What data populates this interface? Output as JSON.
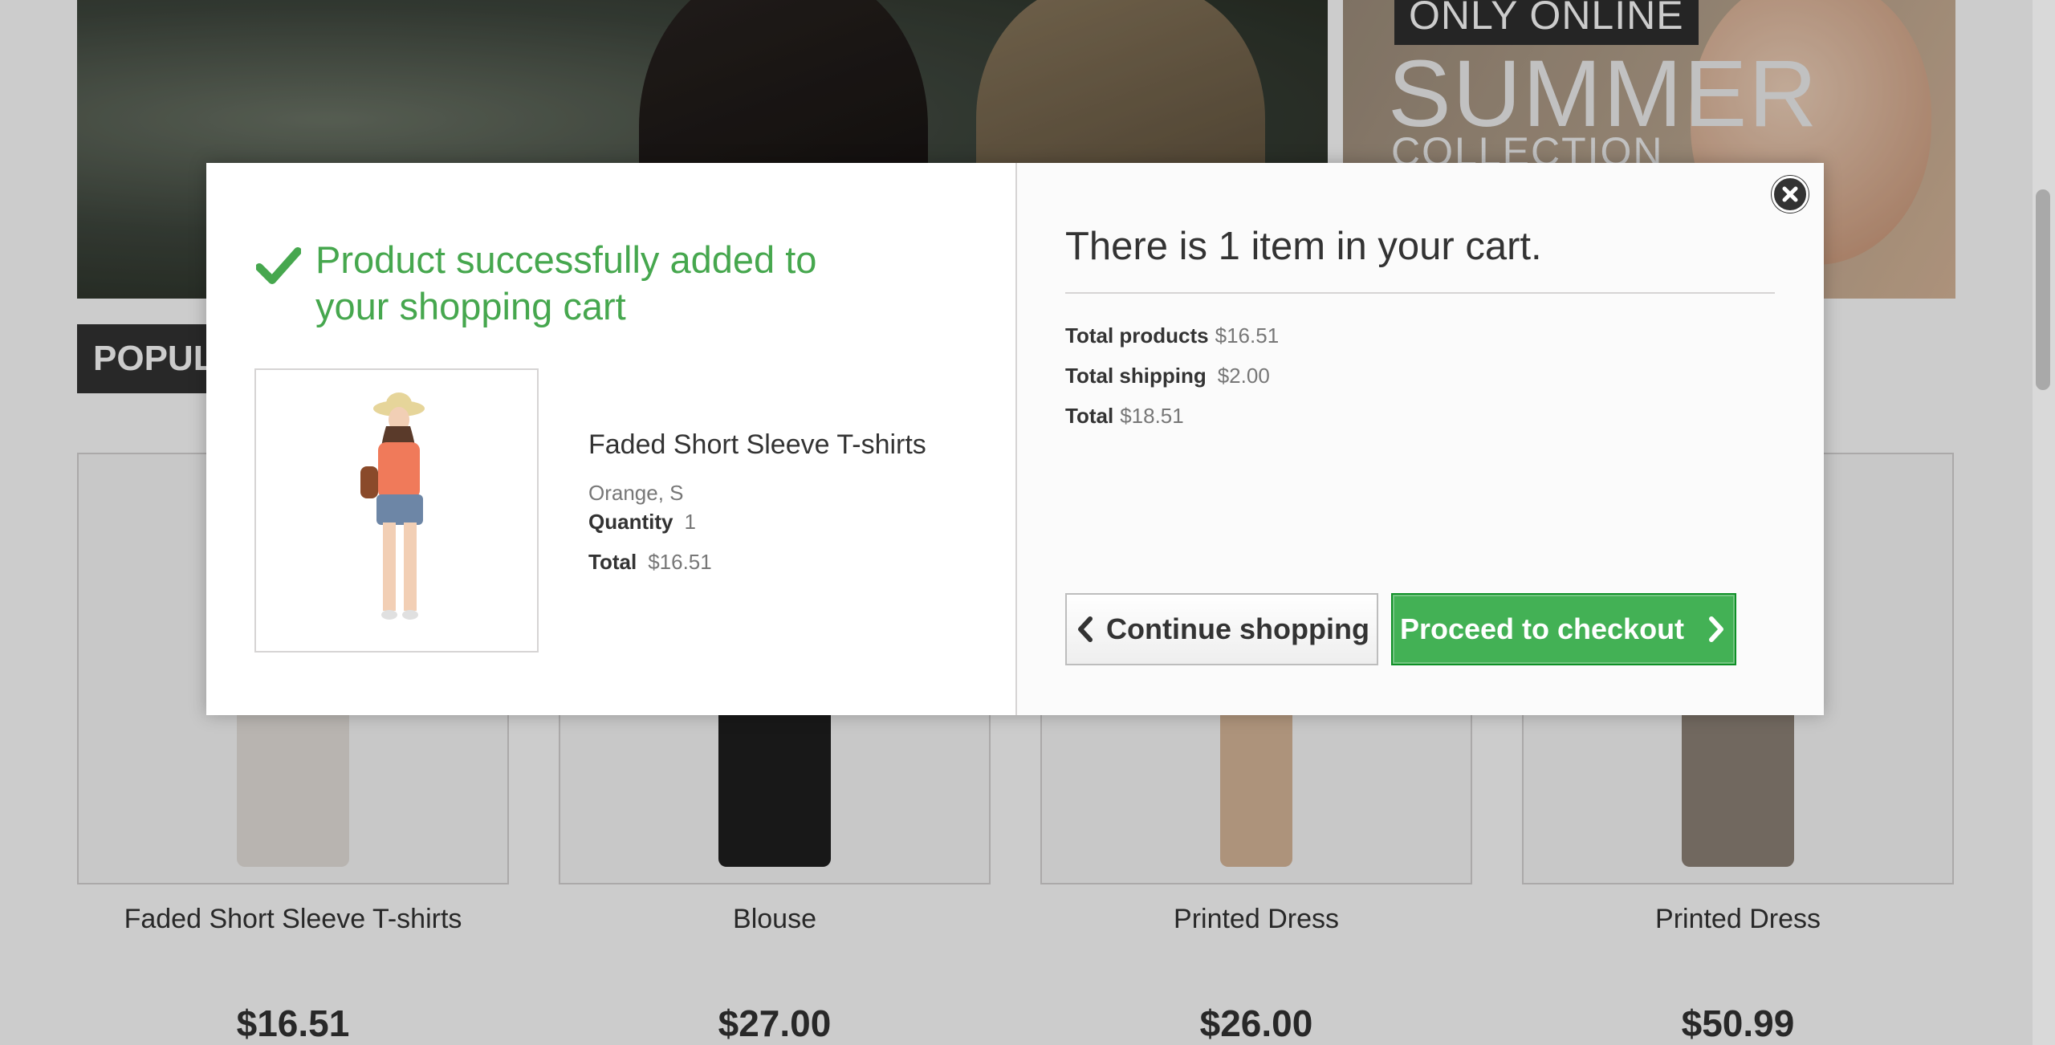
{
  "banner_right": {
    "tag": "ONLY ONLINE",
    "headline": "SUMMER",
    "subheadline": "COLLECTION"
  },
  "section": {
    "tab_label": "POPULAR"
  },
  "products": [
    {
      "name": "Faded Short Sleeve T-shirts",
      "price": "$16.51"
    },
    {
      "name": "Blouse",
      "price": "$27.00"
    },
    {
      "name": "Printed Dress",
      "price": "$26.00"
    },
    {
      "name": "Printed Dress",
      "price": "$50.99"
    }
  ],
  "modal": {
    "success_title": "Product successfully added to your shopping cart",
    "product": {
      "name": "Faded Short Sleeve T-shirts",
      "attributes": "Orange, S",
      "quantity_label": "Quantity",
      "quantity": "1",
      "total_label": "Total",
      "total": "$16.51"
    },
    "cart": {
      "heading": "There is 1 item in your cart.",
      "total_products_label": "Total products",
      "total_products": "$16.51",
      "total_shipping_label": "Total shipping",
      "total_shipping": "$2.00",
      "total_label": "Total",
      "total": "$18.51"
    },
    "buttons": {
      "continue": "Continue shopping",
      "checkout": "Proceed to checkout"
    }
  },
  "colors": {
    "success_green": "#46a74e",
    "checkout_green": "#43b155",
    "dark": "#333333"
  },
  "icons": [
    "check-icon",
    "close-icon",
    "chevron-left-icon",
    "chevron-right-icon"
  ]
}
